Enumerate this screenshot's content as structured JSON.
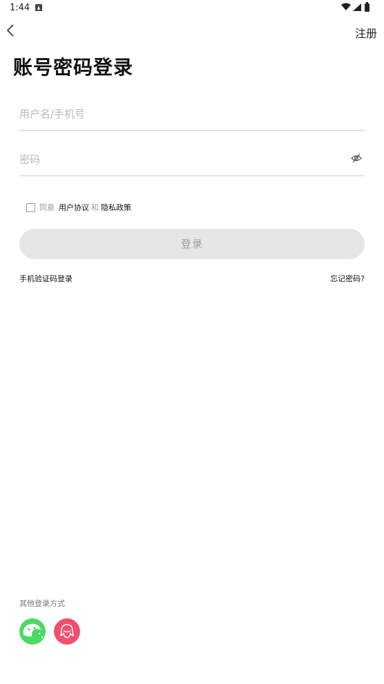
{
  "status_bar": {
    "time": "1:44"
  },
  "header": {
    "register_label": "注册",
    "title": "账号密码登录"
  },
  "form": {
    "username_placeholder": "用户名/手机号",
    "password_placeholder": "密码"
  },
  "agreement": {
    "prefix": "同意",
    "user_agreement": "用户协议",
    "conjunction": "和",
    "privacy_policy": "隐私政策"
  },
  "actions": {
    "login_label": "登录",
    "sms_login_label": "手机验证码登录",
    "forgot_password_label": "忘记密码?"
  },
  "other_login": {
    "label": "其他登录方式",
    "providers": [
      {
        "icon": "wechat-icon",
        "color": "#4cd964"
      },
      {
        "icon": "qq-icon",
        "color": "#f0506e"
      }
    ]
  },
  "colors": {
    "login_button_bg": "#e6e6e6",
    "login_button_text": "#9e9e9e",
    "placeholder": "#b9b9b9",
    "divider": "#cfcfcf"
  }
}
